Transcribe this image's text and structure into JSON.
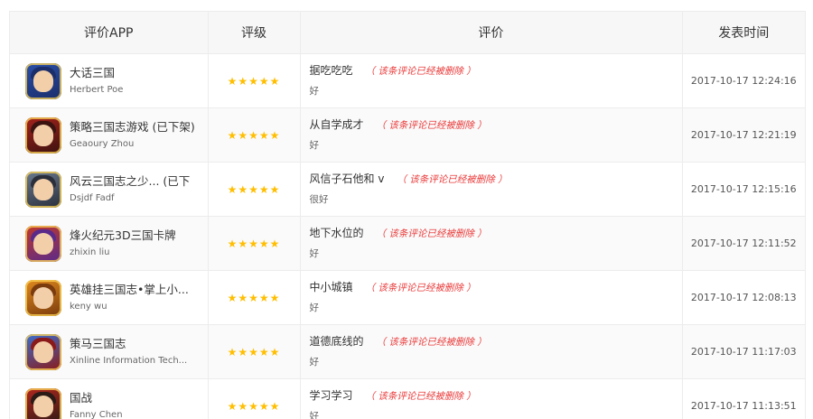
{
  "headers": {
    "app": "评价APP",
    "rating": "评级",
    "review": "评价",
    "time": "发表时间"
  },
  "stars": "★★★★★",
  "deleted_note": "（ 该条评论已经被删除 ）",
  "colors": {
    "star": "#ffbe00",
    "deleted": "#ea3a3a",
    "header_bg": "#f7f7f7"
  },
  "rows": [
    {
      "app_name": "大话三国",
      "developer": "Herbert Poe",
      "rating": 5,
      "title": "据吃吃吃",
      "body": "好",
      "time": "2017-10-17 12:24:16",
      "icon": "game-icon-dahua",
      "icon_colors": [
        "#2a4fa8",
        "#1b2e6a"
      ]
    },
    {
      "app_name": "策略三国志游戏 (已下架)",
      "developer": "Geaoury Zhou",
      "rating": 5,
      "title": "从自学成才",
      "body": "好",
      "time": "2017-10-17 12:21:19",
      "icon": "game-icon-celue",
      "icon_colors": [
        "#a6221c",
        "#3b1310"
      ]
    },
    {
      "app_name": "风云三国志之少... (已下",
      "developer": "Dsjdf Fadf",
      "rating": 5,
      "title": "风信子石他和 v",
      "body": "很好",
      "time": "2017-10-17 12:15:16",
      "icon": "game-icon-fengyun",
      "icon_colors": [
        "#6a7a90",
        "#2a2f3b"
      ]
    },
    {
      "app_name": "烽火纪元3D三国卡牌",
      "developer": "zhixin liu",
      "rating": 5,
      "title": "地下水位的",
      "body": "好",
      "time": "2017-10-17 12:11:52",
      "icon": "game-icon-fenghuo",
      "icon_colors": [
        "#c0392b",
        "#5a2a8a"
      ]
    },
    {
      "app_name": "英雄挂三国志•掌上小...",
      "developer": "keny wu",
      "rating": 5,
      "title": "中小城镇",
      "body": "好",
      "time": "2017-10-17 12:08:13",
      "icon": "game-icon-yingxiong",
      "icon_colors": [
        "#e08a1e",
        "#7a3b0d"
      ]
    },
    {
      "app_name": "策马三国志",
      "developer": "Xinline Information Tech...",
      "rating": 5,
      "title": "道德底线的",
      "body": "好",
      "time": "2017-10-17 11:17:03",
      "icon": "game-icon-cema",
      "icon_colors": [
        "#3a6fd0",
        "#8a1a1a"
      ]
    },
    {
      "app_name": "国战",
      "developer": "Fanny Chen",
      "rating": 5,
      "title": "学习学习",
      "body": "好",
      "time": "2017-10-17 11:13:51",
      "icon": "game-icon-guozhan",
      "icon_colors": [
        "#b3261e",
        "#2b1a16"
      ]
    }
  ]
}
